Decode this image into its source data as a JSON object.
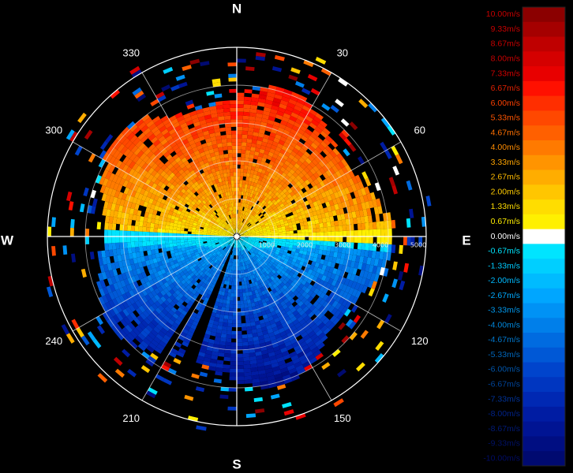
{
  "chart_data": {
    "type": "heatmap",
    "projection": "polar",
    "max_range": 5000,
    "range_rings": [
      1000,
      2000,
      3000,
      4000,
      5000
    ],
    "range_ring_labels": [
      "1000",
      "2000",
      "3000",
      "4000",
      "5000"
    ],
    "radial_spokes_deg": [
      0,
      30,
      60,
      90,
      120,
      150,
      180,
      210,
      240,
      270,
      300,
      330
    ],
    "cardinal_labels": [
      "N",
      "E",
      "S",
      "W"
    ],
    "bearing_labels": [
      "30",
      "60",
      "120",
      "150",
      "210",
      "240",
      "300",
      "330"
    ],
    "grid": true,
    "colorbar": {
      "placement": "right",
      "min": -10.0,
      "max": 10.0,
      "unit": "m/s",
      "labels": [
        "10.00m/s",
        "9.33m/s",
        "8.67m/s",
        "8.00m/s",
        "7.33m/s",
        "6.67m/s",
        "6.00m/s",
        "5.33m/s",
        "4.67m/s",
        "4.00m/s",
        "3.33m/s",
        "2.67m/s",
        "2.00m/s",
        "1.33m/s",
        "0.67m/s",
        "0.00m/s",
        "-0.67m/s",
        "-1.33m/s",
        "-2.00m/s",
        "-2.67m/s",
        "-3.33m/s",
        "-4.00m/s",
        "-4.67m/s",
        "-5.33m/s",
        "-6.00m/s",
        "-6.67m/s",
        "-7.33m/s",
        "-8.00m/s",
        "-8.67m/s",
        "-9.33m/s",
        "-10.00m/s"
      ],
      "colors": [
        "#8b0000",
        "#a50000",
        "#bf0000",
        "#d50000",
        "#e80000",
        "#ff1000",
        "#ff2e00",
        "#ff4800",
        "#ff6000",
        "#ff7a00",
        "#ff9400",
        "#ffad00",
        "#ffc600",
        "#ffdd00",
        "#fff000",
        "#ffffff",
        "#00e4ff",
        "#00cfff",
        "#00bbff",
        "#00a6ff",
        "#0092f5",
        "#007fea",
        "#006be0",
        "#0058d6",
        "#0044cc",
        "#0036c0",
        "#0028b3",
        "#001ca3",
        "#001493",
        "#000e82",
        "#000a70"
      ],
      "label_colors": [
        "#c80000",
        "#c80000",
        "#c80000",
        "#c80000",
        "#d40000",
        "#e02000",
        "#ff4000",
        "#ff5500",
        "#ff7000",
        "#ff8c00",
        "#ffa500",
        "#ffbb00",
        "#ffcc00",
        "#ffdd00",
        "#ffee00",
        "#ffffff",
        "#00e6ff",
        "#00ccff",
        "#00bbff",
        "#00aaff",
        "#0099ee",
        "#0088dd",
        "#0077cc",
        "#0066bb",
        "#0055aa",
        "#004499",
        "#003399",
        "#002288",
        "#001a77",
        "#001166",
        "#000c66"
      ]
    },
    "field": {
      "description_values": "radial wind velocity (m/s): positive (receding, warm) in the northern half, negative (approaching, cool) in the southern half; core ~4000 m",
      "core_range": 4000,
      "outer_range": 5200,
      "north_peak": 7.5,
      "south_peak": -9.0
    }
  }
}
